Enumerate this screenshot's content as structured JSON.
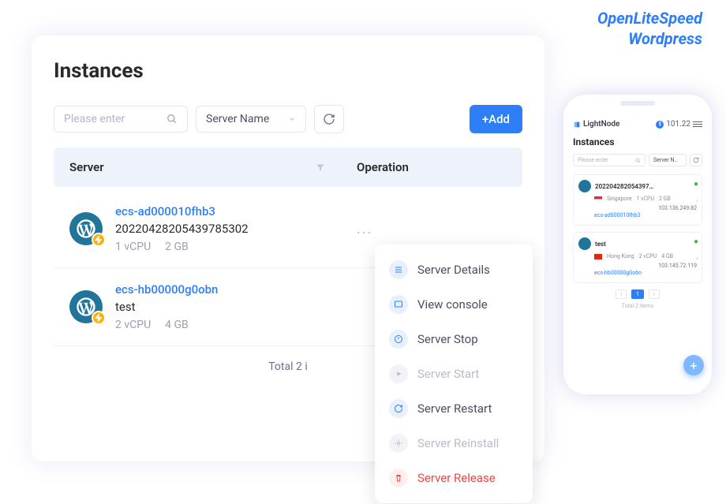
{
  "watermark": {
    "line1": "OpenLiteSpeed",
    "line2": "Wordpress"
  },
  "page": {
    "title": "Instances"
  },
  "toolbar": {
    "search_placeholder": "Please enter",
    "select_label": "Server Name",
    "add_label": "+Add"
  },
  "table": {
    "header_server": "Server",
    "header_operation": "Operation",
    "total_text": "Total 2 i"
  },
  "instances": [
    {
      "link": "ecs-ad000010fhb3",
      "name": "20220428205439785302",
      "cpu": "1 vCPU",
      "ram": "2 GB"
    },
    {
      "link": "ecs-hb00000g0obn",
      "name": "test",
      "cpu": "2 vCPU",
      "ram": "4 GB"
    }
  ],
  "dropdown": [
    {
      "label": "Server Details",
      "state": "normal",
      "icon_bg": "#e8f0ff",
      "icon_color": "#2d7ef7"
    },
    {
      "label": "View console",
      "state": "normal",
      "icon_bg": "#e8f0ff",
      "icon_color": "#2d7ef7"
    },
    {
      "label": "Server Stop",
      "state": "normal",
      "icon_bg": "#e8f0ff",
      "icon_color": "#2d7ef7"
    },
    {
      "label": "Server Start",
      "state": "disabled",
      "icon_bg": "#f2f3f7",
      "icon_color": "#b8bcc9"
    },
    {
      "label": "Server Restart",
      "state": "normal",
      "icon_bg": "#e8f0ff",
      "icon_color": "#2d7ef7"
    },
    {
      "label": "Server Reinstall",
      "state": "disabled",
      "icon_bg": "#f2f3f7",
      "icon_color": "#b8bcc9"
    },
    {
      "label": "Server Release",
      "state": "danger",
      "icon_bg": "#fee",
      "icon_color": "#ef4444"
    }
  ],
  "phone": {
    "brand": "LightNode",
    "balance": "101.22",
    "title": "Instances",
    "search_placeholder": "Please enter",
    "select_label": "Server N…",
    "cards": [
      {
        "name": "202204282054397…",
        "region": "Singapore",
        "cpu": "1 vCPU",
        "ram": "2 GB",
        "link": "ecs-ad000010fhb3",
        "ip": "103.136.249.82",
        "flag": "sg"
      },
      {
        "name": "test",
        "region": "Hong Kong",
        "cpu": "2 vCPU",
        "ram": "4 GB",
        "link": "ecs-hb00000g0obn",
        "ip": "103.145.72.119",
        "flag": "hk"
      }
    ],
    "page_current": "1",
    "total_text": "Total 2 items"
  }
}
